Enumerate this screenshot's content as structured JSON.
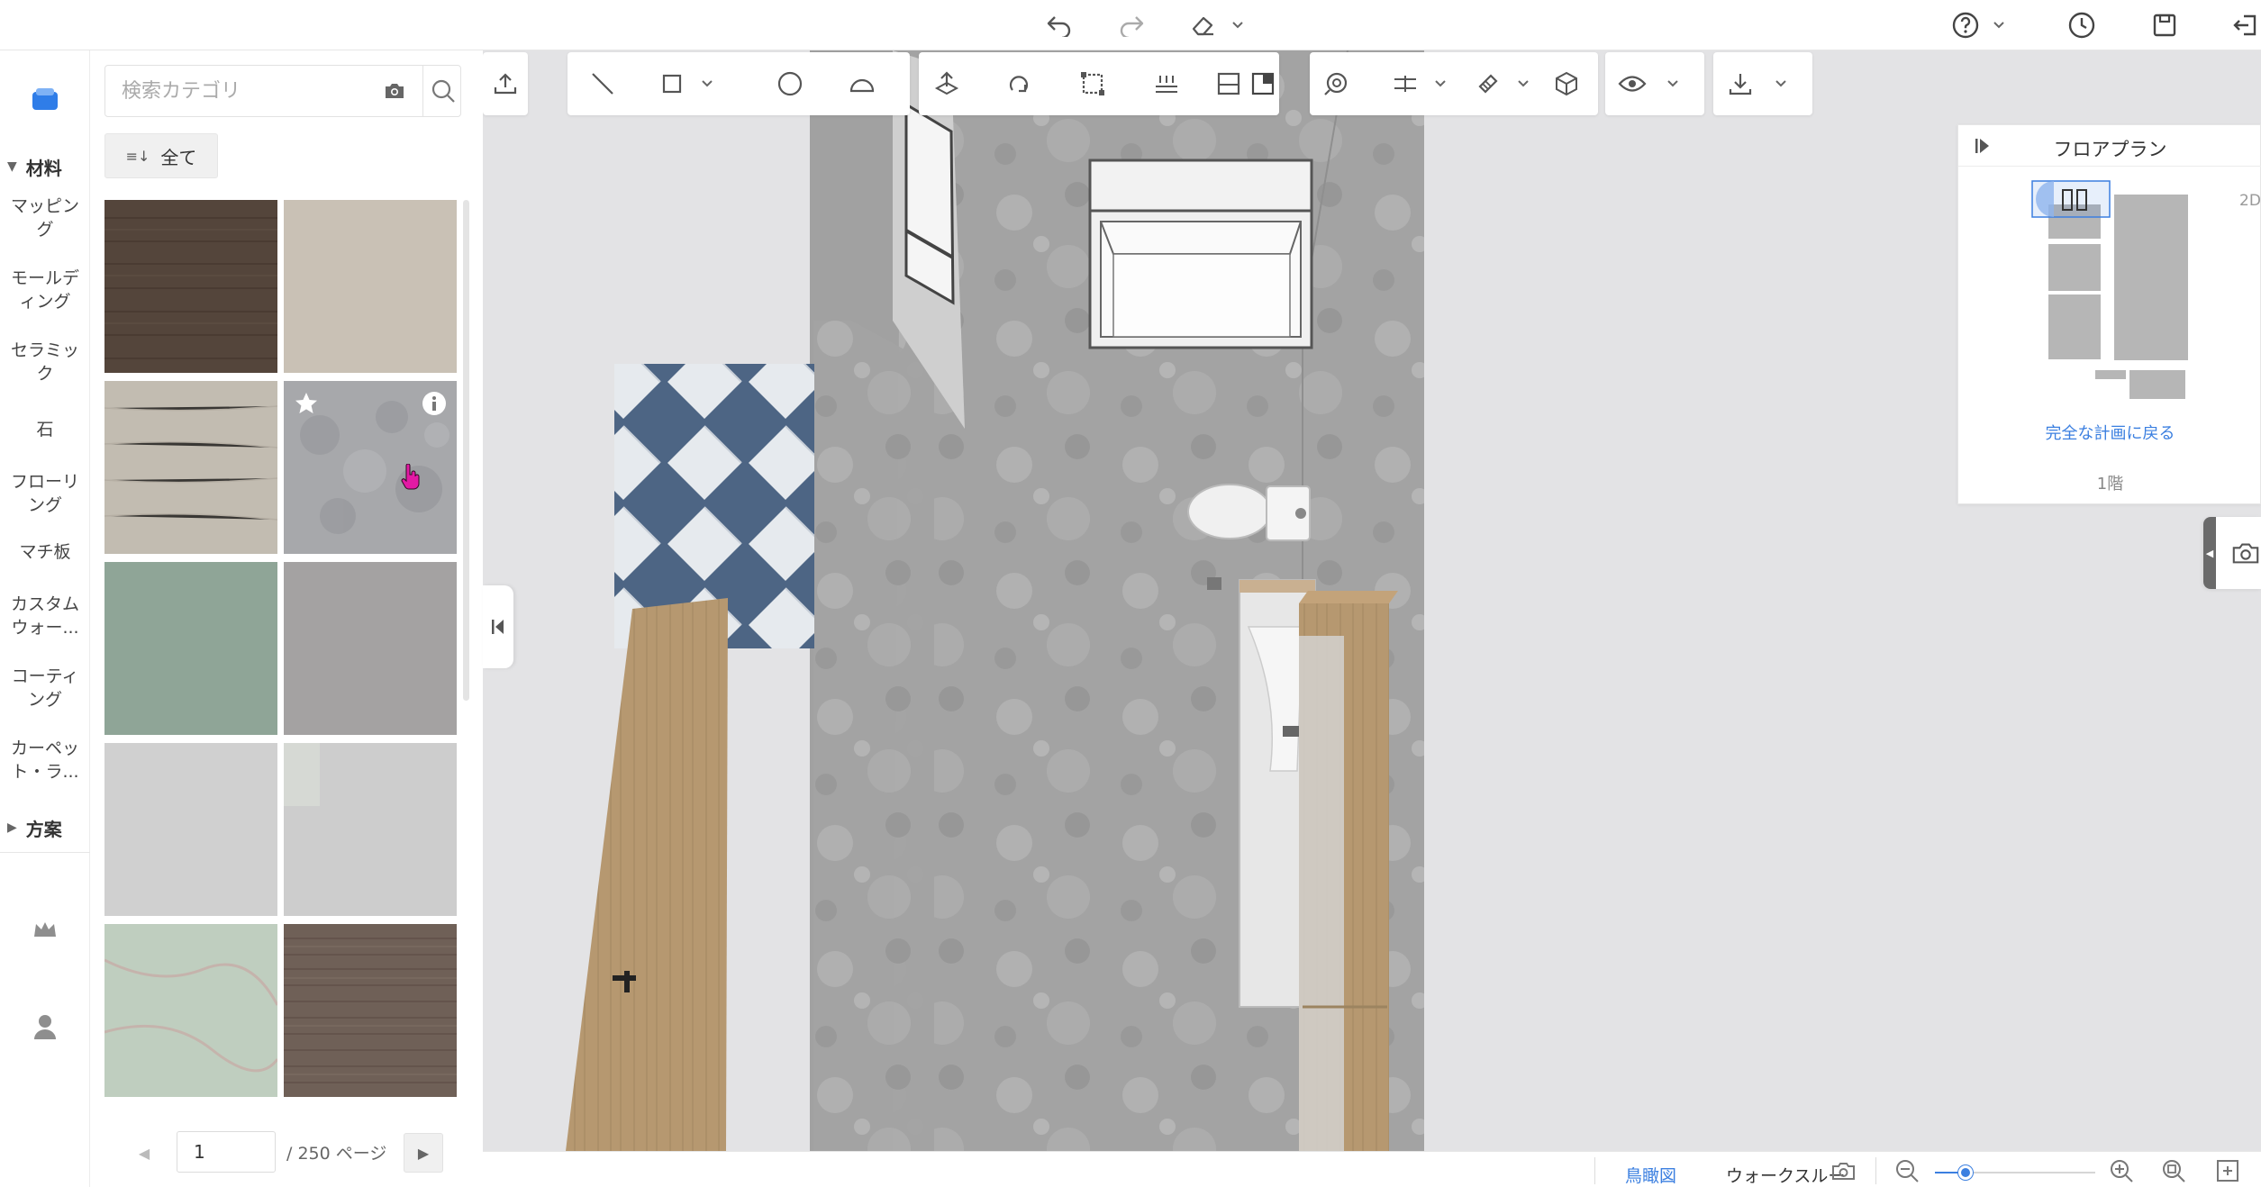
{
  "panel": {
    "search_placeholder": "検索カテゴリ",
    "filter_label": "全て",
    "swatches": [
      {
        "color": "#54453b"
      },
      {
        "color": "#c9c1b5"
      },
      {
        "color": "#c2bcb1"
      },
      {
        "color": "#a7a8ab"
      },
      {
        "color": "#8fa597"
      },
      {
        "color": "#a4a2a2"
      },
      {
        "color": "#d0d0d0"
      },
      {
        "color": "#cdcdcd"
      },
      {
        "color": "#bfcebf"
      },
      {
        "color": "#6f6057"
      }
    ],
    "pager": {
      "current": "1",
      "total_label": "/ 250 ページ"
    }
  },
  "rail": {
    "section_materials": "材料",
    "items": [
      {
        "label": "マッピング"
      },
      {
        "label": "モールディング"
      },
      {
        "label": "セラミック"
      },
      {
        "label": "石"
      },
      {
        "label": "フローリング"
      },
      {
        "label": "マチ板"
      },
      {
        "label": "カスタムウォー..."
      },
      {
        "label": "コーティング"
      },
      {
        "label": "カーペット・ラ..."
      }
    ],
    "section_plans": "方案"
  },
  "floorplan": {
    "title": "フロアプラン",
    "mode_label": "2D",
    "back_link": "完全な計画に戻る",
    "floor_label": "1階"
  },
  "bottom": {
    "birdseye_label": "鳥瞰図",
    "walkthrough_label": "ウォークスルー",
    "zoom_level": 0.19
  },
  "colors": {
    "accent": "#3b7fe0",
    "wall": "#9f9f9f",
    "tile_blue": "#4d6584",
    "tile_white": "#e6eaee",
    "wood": "#b69870"
  }
}
